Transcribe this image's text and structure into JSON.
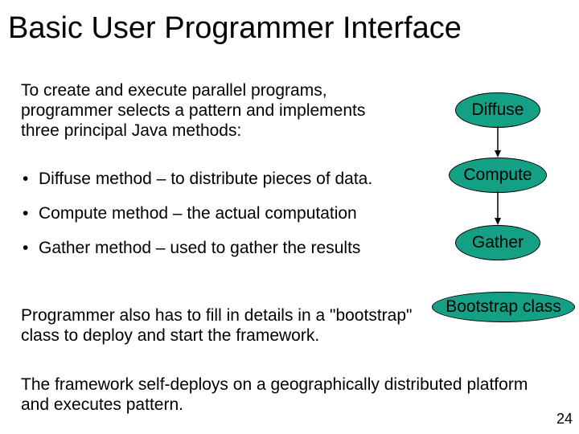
{
  "title": "Basic User Programmer Interface",
  "intro": "To create and execute parallel programs, programmer selects a pattern and implements three principal Java methods:",
  "bullets": [
    "Diffuse method – to distribute pieces of data.",
    "Compute method – the actual computation",
    "Gather method – used to gather the results"
  ],
  "para_bootstrap": "Programmer also has to fill in details in a \"bootstrap\" class to deploy and start the framework.",
  "para_framework": "The framework self-deploys on a geographically distributed platform and executes pattern.",
  "ellipses": {
    "diffuse": "Diffuse",
    "compute": "Compute",
    "gather": "Gather",
    "bootstrap": "Bootstrap class"
  },
  "pagenum": "24"
}
